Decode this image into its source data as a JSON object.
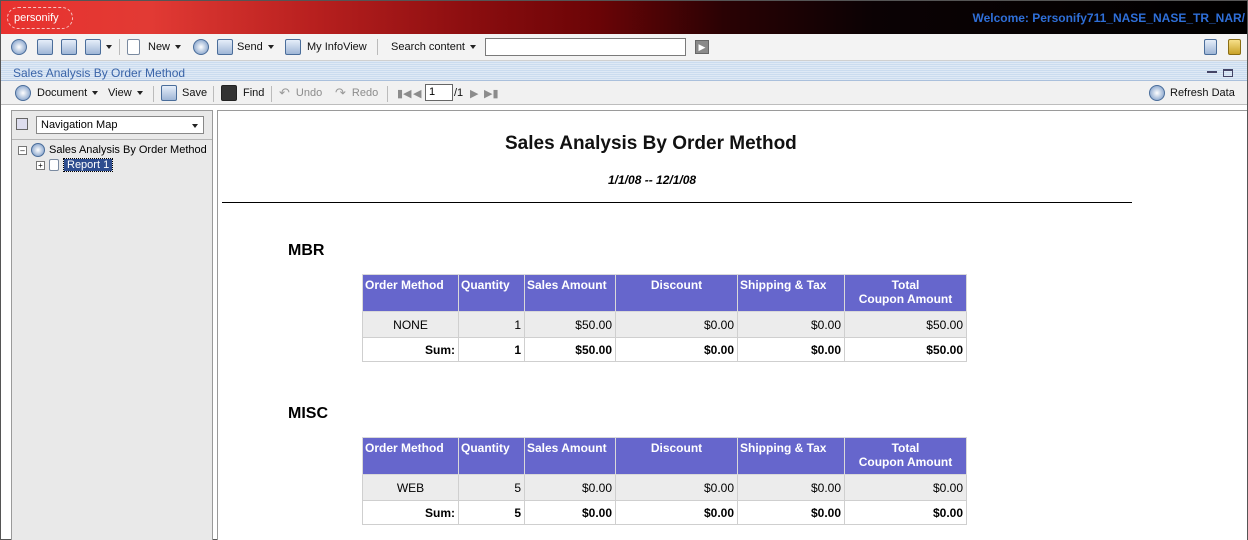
{
  "banner": {
    "logo": "personify",
    "welcome": "Welcome: Personify711_NASE_NASE_TR_NAR/"
  },
  "toolbar": {
    "new_label": "New",
    "send_label": "Send",
    "myinfoview_label": "My InfoView",
    "search_label": "Search content",
    "search_value": ""
  },
  "document": {
    "title": "Sales Analysis By Order Method",
    "menu_document": "Document",
    "menu_view": "View",
    "save_label": "Save",
    "find_label": "Find",
    "undo_label": "Undo",
    "redo_label": "Redo",
    "page_current": "1",
    "page_total": "/1",
    "refresh_label": "Refresh Data"
  },
  "nav": {
    "select_value": "Navigation Map",
    "root_label": "Sales Analysis By Order Method",
    "child_label": "Report 1"
  },
  "report": {
    "title": "Sales Analysis By Order Method",
    "dates": "1/1/08  --  12/1/08",
    "headers": [
      "Order Method",
      "Quantity",
      "Sales Amount",
      "Discount",
      "Shipping & Tax",
      "Total"
    ],
    "header_total_line2": "Coupon Amount",
    "sections": [
      {
        "name": "MBR",
        "row": [
          "NONE",
          "1",
          "$50.00",
          "$0.00",
          "$0.00",
          "$50.00"
        ],
        "sum": [
          "Sum:",
          "1",
          "$50.00",
          "$0.00",
          "$0.00",
          "$50.00"
        ]
      },
      {
        "name": "MISC",
        "row": [
          "WEB",
          "5",
          "$0.00",
          "$0.00",
          "$0.00",
          "$0.00"
        ],
        "sum": [
          "Sum:",
          "5",
          "$0.00",
          "$0.00",
          "$0.00",
          "$0.00"
        ]
      }
    ]
  }
}
